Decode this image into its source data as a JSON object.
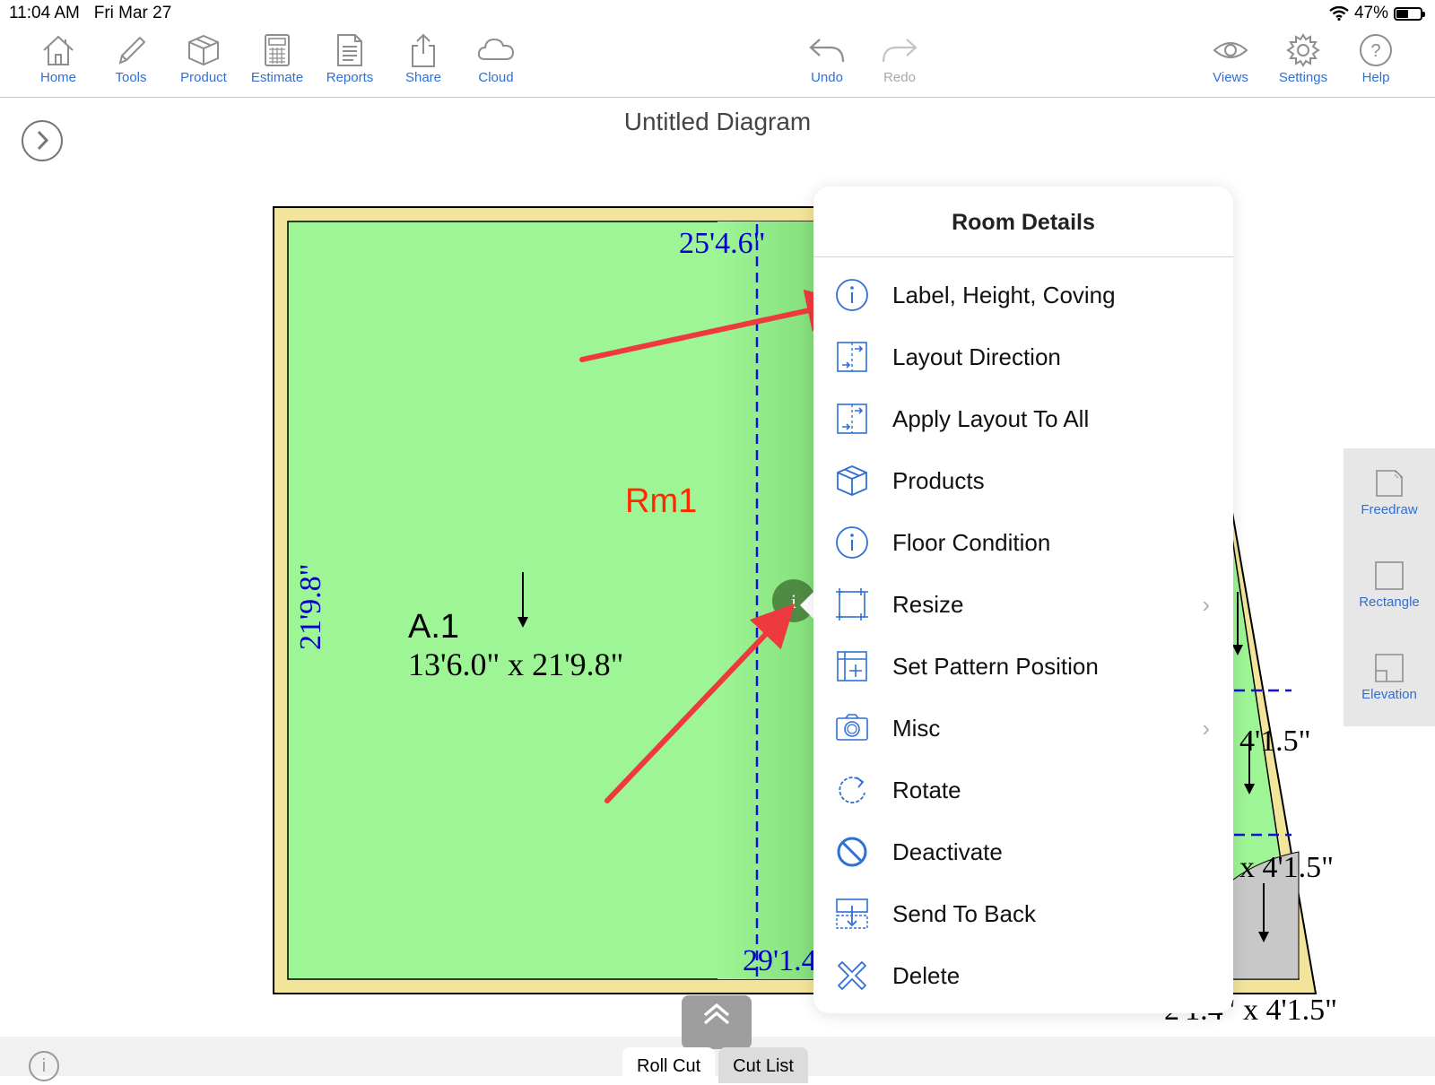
{
  "status_bar": {
    "time": "11:04 AM",
    "date": "Fri Mar 27",
    "battery": "47%",
    "battery_level": 0.47,
    "wifi_icon": "wifi-icon"
  },
  "toolbar": {
    "left": [
      {
        "label": "Home",
        "icon": "home-icon"
      },
      {
        "label": "Tools",
        "icon": "pencil-icon"
      },
      {
        "label": "Product",
        "icon": "box-icon"
      },
      {
        "label": "Estimate",
        "icon": "calculator-icon"
      },
      {
        "label": "Reports",
        "icon": "document-icon"
      },
      {
        "label": "Share",
        "icon": "share-icon"
      },
      {
        "label": "Cloud",
        "icon": "cloud-icon"
      }
    ],
    "center": [
      {
        "label": "Undo",
        "icon": "undo-icon",
        "enabled": true
      },
      {
        "label": "Redo",
        "icon": "redo-icon",
        "enabled": false
      }
    ],
    "right": [
      {
        "label": "Views",
        "icon": "eye-icon"
      },
      {
        "label": "Settings",
        "icon": "gear-icon"
      },
      {
        "label": "Help",
        "icon": "help-icon"
      }
    ]
  },
  "diagram": {
    "title": "Untitled Diagram",
    "room_name": "Rm1",
    "area_label": "A.1",
    "area_size": "13'6.0\" x 21'9.8\"",
    "dim_top": "25'4.6\"",
    "dim_bottom": "29'1.4",
    "dim_left": "21'9.8\"",
    "right_dims": [
      "4'1.5\"",
      "x 4'1.5\"",
      "2'1.4\" x 4'1.5\""
    ],
    "colors": {
      "room_fill": "#9ef595",
      "border": "#f2e49a",
      "dim_text": "#0000cc",
      "room_label": "#ff2a00",
      "annotation_arrow": "#ee3a3e"
    }
  },
  "side_tools": [
    {
      "label": "Freedraw",
      "icon": "freedraw-icon"
    },
    {
      "label": "Rectangle",
      "icon": "rectangle-icon"
    },
    {
      "label": "Elevation",
      "icon": "elevation-icon"
    }
  ],
  "room_details": {
    "title": "Room Details",
    "items": [
      {
        "label": "Label, Height, Coving",
        "icon": "info-icon",
        "submenu": false
      },
      {
        "label": "Layout Direction",
        "icon": "layout-direction-icon",
        "submenu": false
      },
      {
        "label": "Apply Layout To All",
        "icon": "layout-direction-icon",
        "submenu": false
      },
      {
        "label": "Products",
        "icon": "box-icon",
        "submenu": false
      },
      {
        "label": "Floor Condition",
        "icon": "info-icon",
        "submenu": false
      },
      {
        "label": "Resize",
        "icon": "resize-icon",
        "submenu": true
      },
      {
        "label": "Set Pattern Position",
        "icon": "pattern-position-icon",
        "submenu": false
      },
      {
        "label": "Misc",
        "icon": "camera-icon",
        "submenu": true
      },
      {
        "label": "Rotate",
        "icon": "rotate-icon",
        "submenu": false
      },
      {
        "label": "Deactivate",
        "icon": "prohibit-icon",
        "submenu": false
      },
      {
        "label": "Send To Back",
        "icon": "send-to-back-icon",
        "submenu": false
      },
      {
        "label": "Delete",
        "icon": "delete-icon",
        "submenu": false
      }
    ],
    "chevron": "›"
  },
  "bottom": {
    "info_glyph": "i",
    "tabs": [
      {
        "label": "Roll Cut",
        "active": true
      },
      {
        "label": "Cut List",
        "active": false
      }
    ]
  }
}
